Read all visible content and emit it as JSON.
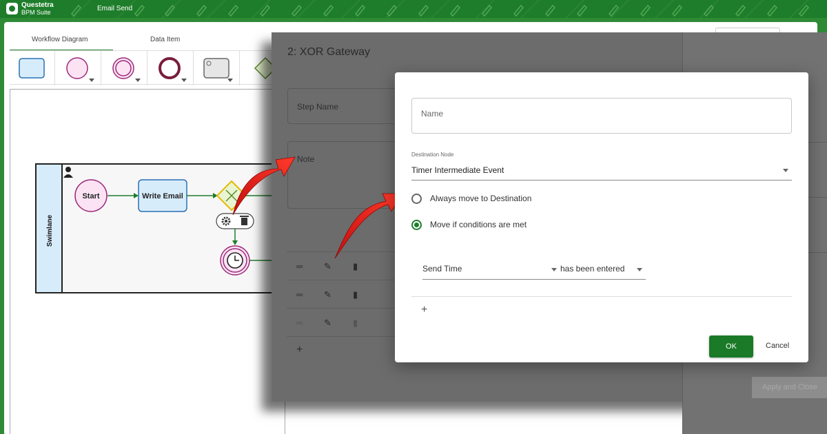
{
  "header": {
    "brand_line1": "Questetra",
    "brand_line2": "BPM Suite",
    "app_title": "Email Send"
  },
  "editor": {
    "tabs": [
      {
        "label": "Workflow Diagram",
        "active": true
      },
      {
        "label": "Data Item",
        "active": false
      }
    ],
    "palette_icons": [
      "human-task-icon",
      "start-event-icon",
      "intermediate-event-icon",
      "end-event-icon",
      "service-task-icon",
      "gateway-icon"
    ],
    "diagram": {
      "swimlane_label": "Swimlane",
      "start_label": "Start",
      "task_label": "Write Email"
    }
  },
  "step_panel": {
    "title": "2: XOR Gateway",
    "step_name_label": "Step Name",
    "note_label": "Note",
    "apply_label": "Apply and Close"
  },
  "dialog": {
    "name_placeholder": "Name",
    "destination_label": "Destination Node",
    "destination_value": "Timer Intermediate Event",
    "options": [
      {
        "label": "Always move to Destination",
        "selected": false
      },
      {
        "label": "Move if conditions are met",
        "selected": true
      }
    ],
    "condition": {
      "field": "Send Time",
      "operator": "has been entered"
    },
    "add_symbol": "+",
    "ok_label": "OK",
    "cancel_label": "Cancel"
  },
  "colors": {
    "brand_green": "#1e7d2a",
    "arrow_red": "#e0201c",
    "task_fill": "#d7ecfb",
    "event_fill": "#fbe3f4",
    "gateway_fill": "#e8f5d0"
  }
}
